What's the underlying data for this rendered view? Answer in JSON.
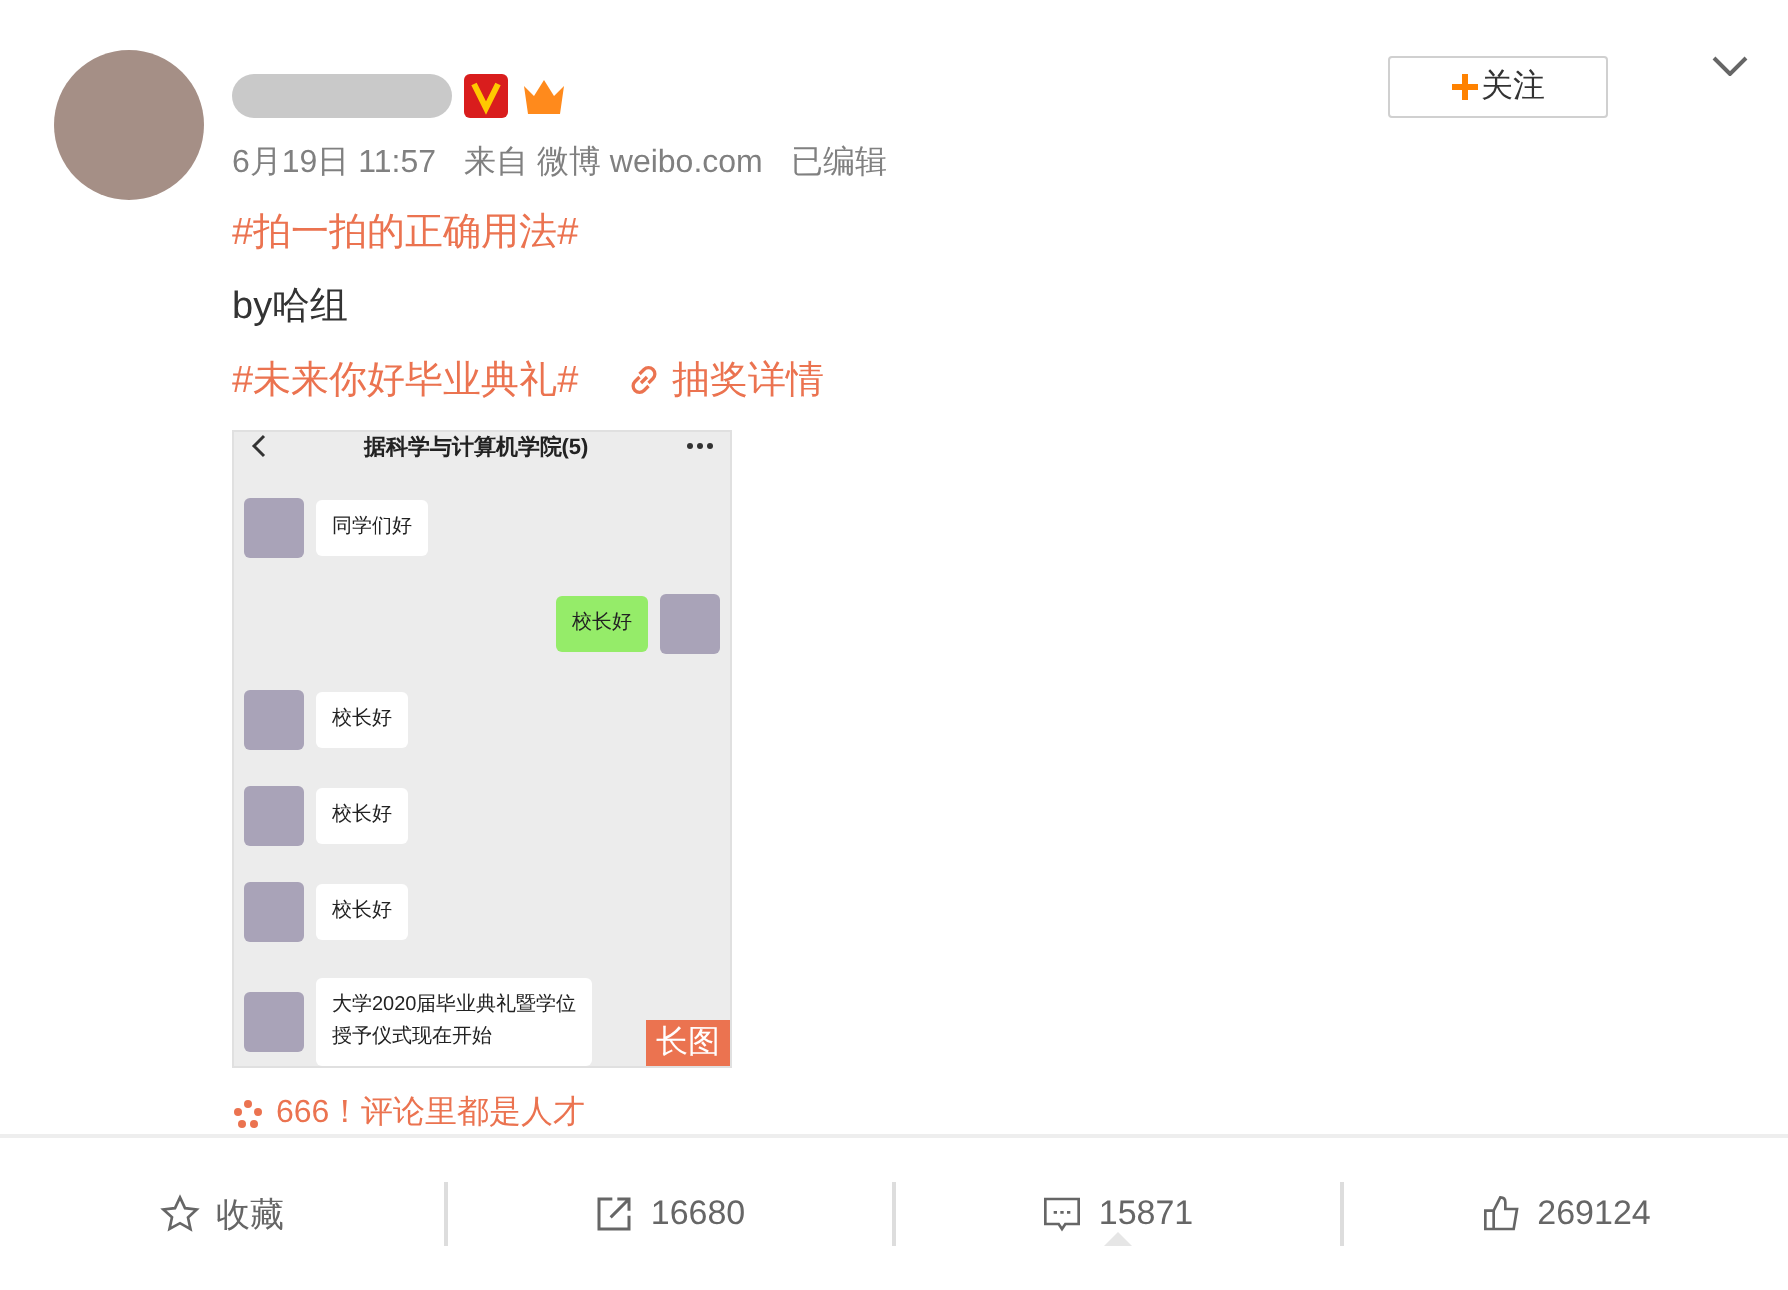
{
  "follow_button": {
    "label": "关注"
  },
  "meta": {
    "time": "6月19日 11:57",
    "source": "来自 微博 weibo.com",
    "edited": "已编辑"
  },
  "content": [
    {
      "kind": "topic",
      "text": "#拍一拍的正确用法#"
    },
    {
      "kind": "plain",
      "text": "by哈组"
    },
    {
      "kind": "topic",
      "text": "#未来你好毕业典礼#",
      "link": "抽奖详情"
    }
  ],
  "image": {
    "chat_title": "据科学与计算机学院(5)",
    "messages": [
      {
        "kind": "received",
        "lines": [
          "同学们好"
        ]
      },
      {
        "kind": "sent",
        "lines": [
          "校长好"
        ]
      },
      {
        "kind": "received",
        "lines": [
          "校长好"
        ]
      },
      {
        "kind": "received",
        "lines": [
          "校长好"
        ]
      },
      {
        "kind": "received",
        "lines": [
          "校长好"
        ]
      },
      {
        "kind": "received",
        "lines": [
          "大学2020届毕业典礼暨学位",
          "授予仪式现在开始"
        ]
      }
    ],
    "badge": "长图"
  },
  "hot_comment": "666！评论里都是人才",
  "actions": [
    {
      "kind": "favorite",
      "label": "收藏",
      "selected": false
    },
    {
      "kind": "share",
      "label": "16680",
      "selected": false
    },
    {
      "kind": "comment",
      "label": "15871",
      "selected": true
    },
    {
      "kind": "like",
      "label": "269124",
      "selected": false
    }
  ]
}
